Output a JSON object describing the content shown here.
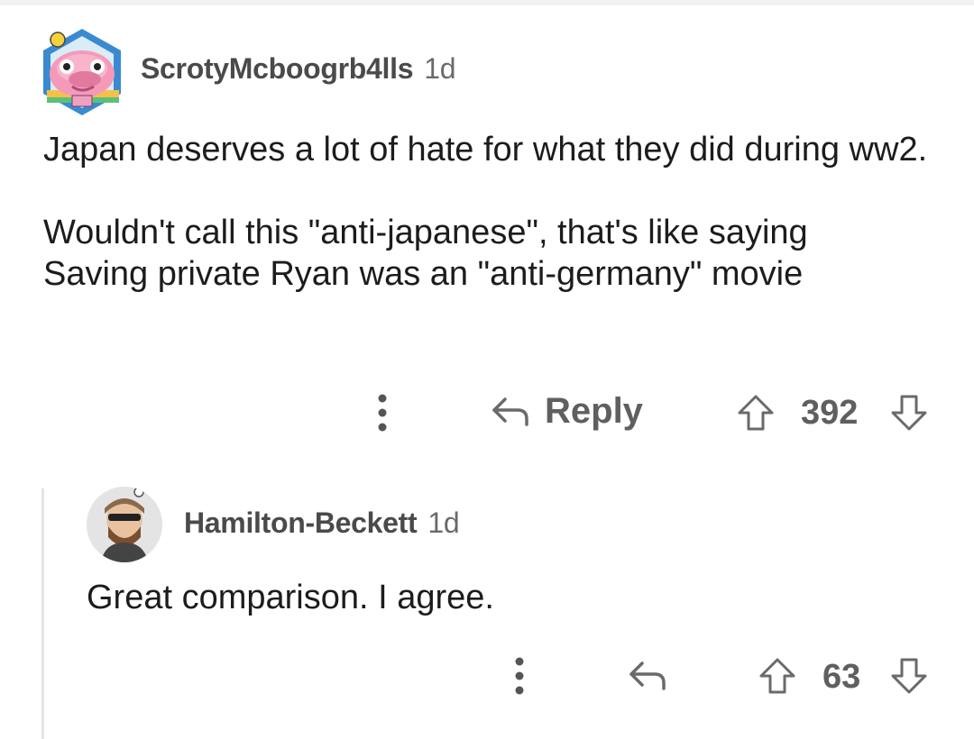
{
  "comments": [
    {
      "username": "ScrotyMcboogrb4lls",
      "age": "1d",
      "paragraphs": [
        "Japan deserves a lot of hate for what they did during ww2.",
        "Wouldn't call this \"anti-japanese\", that's like saying Saving private Ryan was an \"anti-germany\" movie"
      ],
      "reply_label": "Reply",
      "score": "392"
    },
    {
      "username": "Hamilton-Beckett",
      "age": "1d",
      "paragraphs": [
        "Great comparison. I agree."
      ],
      "score": "63"
    }
  ]
}
